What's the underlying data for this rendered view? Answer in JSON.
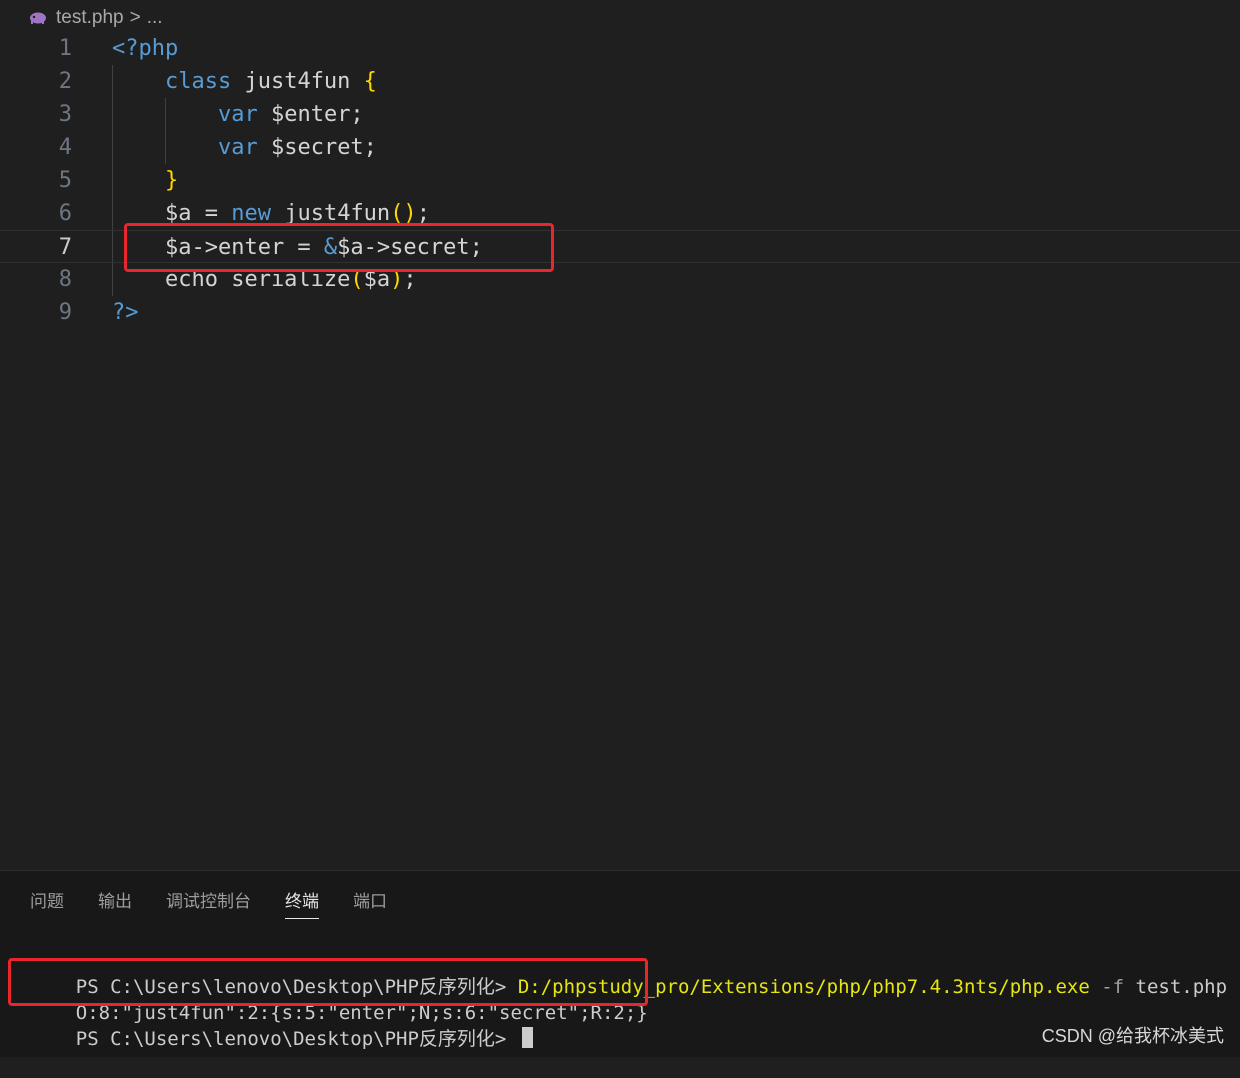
{
  "breadcrumb": {
    "file": "test.php",
    "separator": ">",
    "more": "..."
  },
  "editor": {
    "lines": [
      {
        "n": "1",
        "tokens": [
          {
            "t": "<?php",
            "c": "t-tag"
          }
        ]
      },
      {
        "n": "2",
        "tokens": [
          {
            "t": "    "
          },
          {
            "t": "class",
            "c": "t-kw"
          },
          {
            "t": " just4fun ",
            "c": "t-pl"
          },
          {
            "t": "{",
            "c": "t-br"
          }
        ]
      },
      {
        "n": "3",
        "tokens": [
          {
            "t": "        "
          },
          {
            "t": "var",
            "c": "t-kw"
          },
          {
            "t": " $enter;",
            "c": "t-pl"
          }
        ]
      },
      {
        "n": "4",
        "tokens": [
          {
            "t": "        "
          },
          {
            "t": "var",
            "c": "t-kw"
          },
          {
            "t": " $secret;",
            "c": "t-pl"
          }
        ]
      },
      {
        "n": "5",
        "tokens": [
          {
            "t": "    "
          },
          {
            "t": "}",
            "c": "t-br"
          }
        ]
      },
      {
        "n": "6",
        "tokens": [
          {
            "t": "    $a = ",
            "c": "t-pl"
          },
          {
            "t": "new",
            "c": "t-kw"
          },
          {
            "t": " just4fun",
            "c": "t-pl"
          },
          {
            "t": "()",
            "c": "t-br"
          },
          {
            "t": ";",
            "c": "t-pl"
          }
        ]
      },
      {
        "n": "7",
        "tokens": [
          {
            "t": "    $a->enter = ",
            "c": "t-pl"
          },
          {
            "t": "&",
            "c": "t-kw"
          },
          {
            "t": "$a->secret;",
            "c": "t-pl"
          }
        ]
      },
      {
        "n": "8",
        "tokens": [
          {
            "t": "    echo serialize",
            "c": "t-pl"
          },
          {
            "t": "(",
            "c": "t-br"
          },
          {
            "t": "$a",
            "c": "t-pl"
          },
          {
            "t": ")",
            "c": "t-br"
          },
          {
            "t": ";",
            "c": "t-pl"
          }
        ]
      },
      {
        "n": "9",
        "tokens": [
          {
            "t": "?>",
            "c": "t-tag"
          }
        ]
      }
    ],
    "current_line": 7
  },
  "panel": {
    "tabs": [
      {
        "label": "问题",
        "active": false
      },
      {
        "label": "输出",
        "active": false
      },
      {
        "label": "调试控制台",
        "active": false
      },
      {
        "label": "终端",
        "active": true
      },
      {
        "label": "端口",
        "active": false
      }
    ],
    "terminal": {
      "line1_prompt": "PS C:\\Users\\lenovo\\Desktop\\PHP反序列化> ",
      "line1_exe": "D:/phpstudy_pro/Extensions/php/php7.4.3nts/php.exe",
      "line1_flag": " -f",
      "line1_arg": " test.php",
      "line2_output": "O:8:\"just4fun\":2:{s:5:\"enter\";N;s:6:\"secret\";R:2;}",
      "line3_prompt": "PS C:\\Users\\lenovo\\Desktop\\PHP反序列化> "
    }
  },
  "watermark": "CSDN @给我杯冰美式",
  "colors": {
    "highlight_box": "#e8262b",
    "keyword": "#569cd6",
    "bracket": "#ffd700",
    "terminal_path": "#e5e510"
  }
}
